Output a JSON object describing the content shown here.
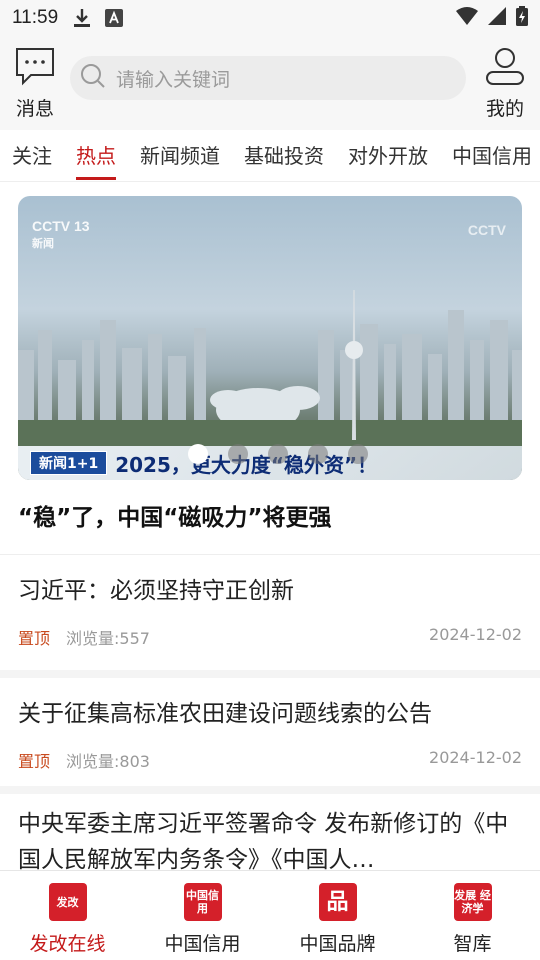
{
  "status_bar": {
    "time": "11:59"
  },
  "header": {
    "message_label": "消息",
    "search_placeholder": "请输入关键词",
    "mine_label": "我的"
  },
  "tabs": [
    {
      "label": "关注"
    },
    {
      "label": "热点"
    },
    {
      "label": "新闻频道"
    },
    {
      "label": "基础投资"
    },
    {
      "label": "对外开放"
    },
    {
      "label": "中国信用"
    }
  ],
  "active_tab": "热点",
  "banner": {
    "logo_text": "CCTV 13",
    "logo_sub": "新闻",
    "watermark": "CCTV",
    "caption_tag": "新闻1+1",
    "caption_text": "2025，更大力度“稳外资”！",
    "title": "“稳”了，中国“磁吸力”将更强",
    "page_count": 5,
    "active_page": 0
  },
  "news": [
    {
      "title": "习近平：必须坚持守正创新",
      "pin": "置顶",
      "views": "浏览量:557",
      "date": "2024-12-02"
    },
    {
      "title": "关于征集高标准农田建设问题线索的公告",
      "pin": "置顶",
      "views": "浏览量:803",
      "date": "2024-12-02"
    },
    {
      "title": "中央军委主席习近平签署命令 发布新修订的《中国人民解放军内务条令》《中国人…"
    }
  ],
  "bottom_nav": [
    {
      "label": "发改在线",
      "icon_text": "发改",
      "icon": "fagai-icon"
    },
    {
      "label": "中国信用",
      "icon_text": "中国信用",
      "icon": "credit-icon"
    },
    {
      "label": "中国品牌",
      "icon_text": "品",
      "icon": "brand-icon"
    },
    {
      "label": "智库",
      "icon_text": "发展 经济学",
      "icon": "think-tank-icon"
    }
  ],
  "colors": {
    "accent": "#c41a1a",
    "brand_red": "#d4202a",
    "pin": "#c84a1e"
  }
}
